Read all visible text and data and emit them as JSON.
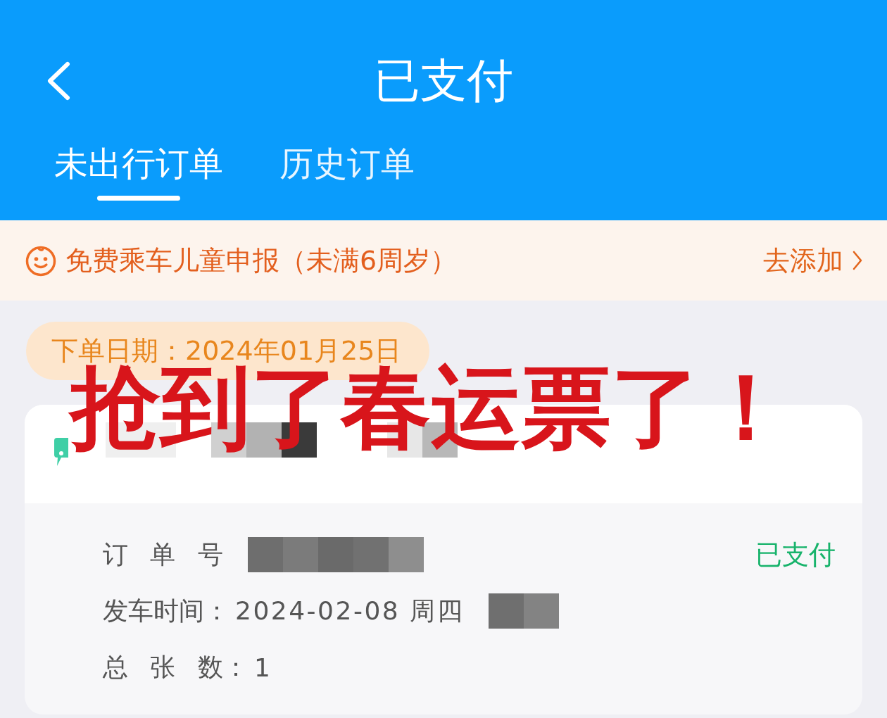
{
  "header": {
    "title": "已支付",
    "tabs": [
      {
        "label": "未出行订单",
        "selected": true
      },
      {
        "label": "历史订单",
        "selected": false
      }
    ]
  },
  "notice": {
    "text": "免费乘车儿童申报（未满6周岁）",
    "action": "去添加"
  },
  "order": {
    "date": "下单日期：2024年01月25日",
    "status": "已支付",
    "details": [
      {
        "label": "订 单 号",
        "redacted": true
      },
      {
        "label": "发车时间：",
        "value": "2024-02-08 周四",
        "redacted": true
      },
      {
        "label": "总 张 数：",
        "value": "1",
        "redacted": false
      }
    ]
  },
  "caption": "抢到了春运票了！"
}
